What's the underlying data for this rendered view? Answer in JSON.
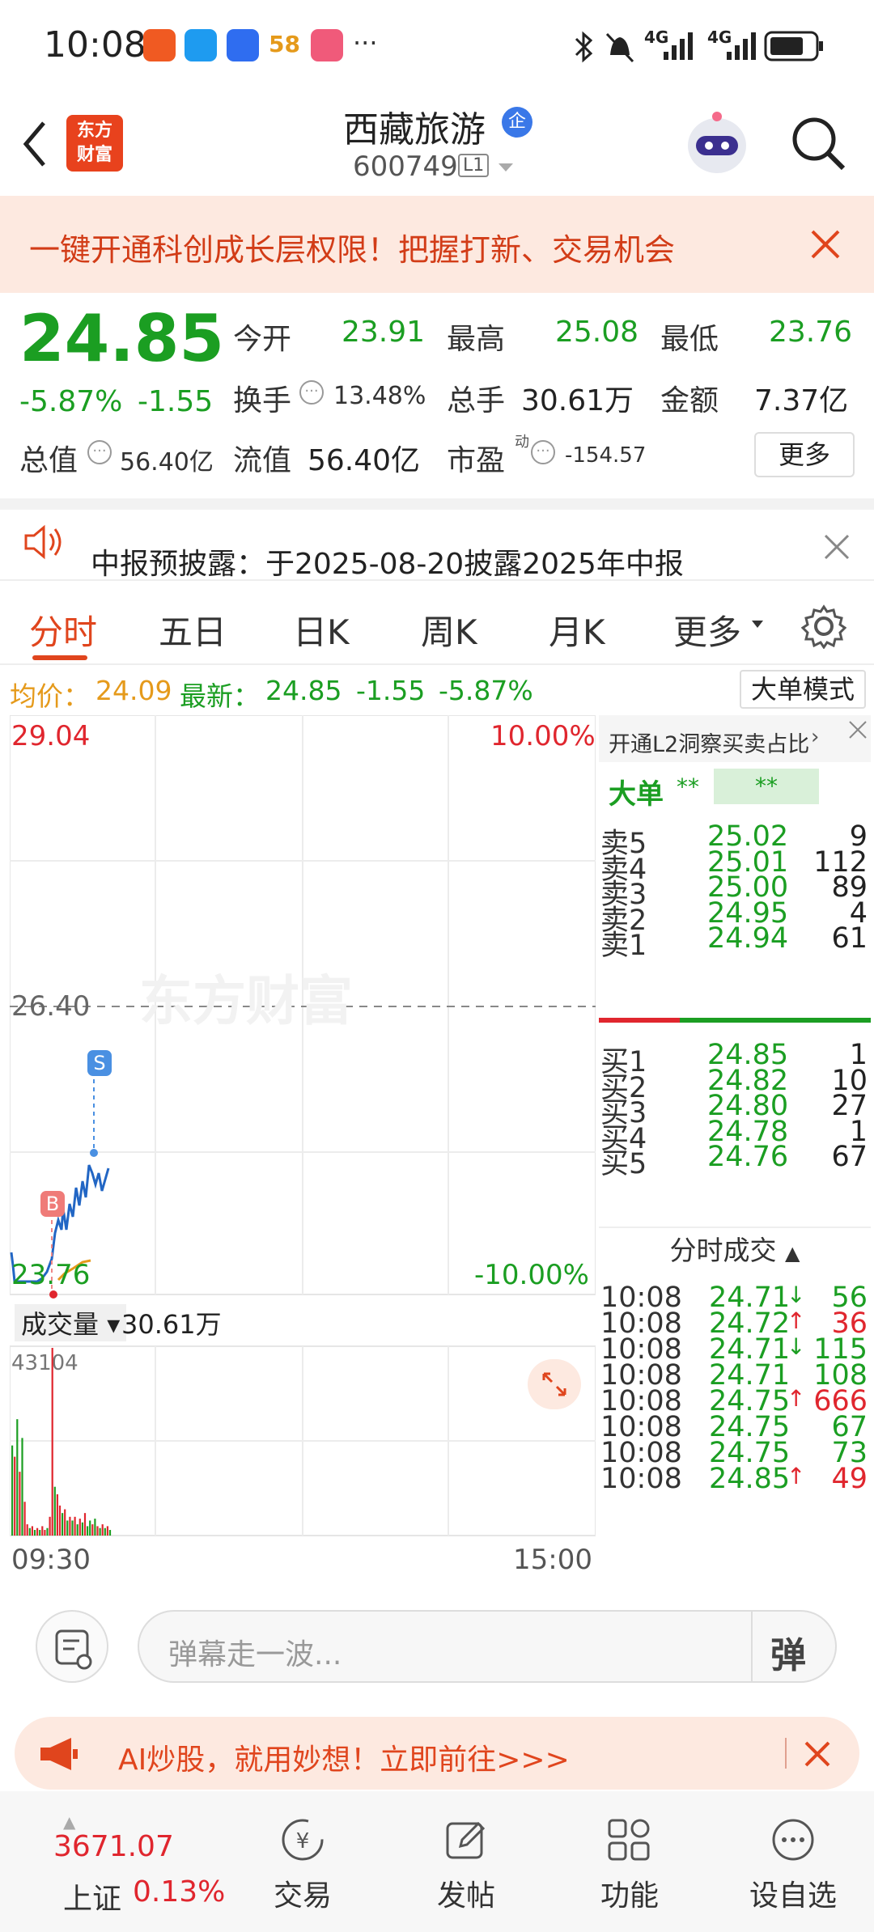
{
  "status_bar": {
    "time": "10:08",
    "more": "···",
    "net1": "4G",
    "net2": "4G"
  },
  "header": {
    "back": "‹",
    "logo_line1": "东方",
    "logo_line2": "财富",
    "title": "西藏旅游",
    "title_badge": "企",
    "code": "600749",
    "level": "L1"
  },
  "banner": {
    "text": "一键开通科创成长层权限！把握打新、交易机会"
  },
  "quote": {
    "price": "24.85",
    "change_pct": "-5.87%",
    "change": "-1.55",
    "open_label": "今开",
    "open": "23.91",
    "high_label": "最高",
    "high": "25.08",
    "low_label": "最低",
    "low": "23.76",
    "turnover_label": "换手",
    "turnover": "13.48%",
    "volume_label": "总手",
    "volume": "30.61万",
    "amount_label": "金额",
    "amount": "7.37亿",
    "mcap_label": "总值",
    "mcap": "56.40亿",
    "float_label": "流值",
    "float": "56.40亿",
    "pe_label": "市盈",
    "pe_sup": "动",
    "pe": "-154.57",
    "more_button": "更多"
  },
  "notice": {
    "text": "中报预披露：于2025-08-20披露2025年中报"
  },
  "tabs": [
    "分时",
    "五日",
    "日K",
    "周K",
    "月K",
    "更多"
  ],
  "price_line": {
    "avg_label": "均价：",
    "avg": "24.09",
    "last_label": "最新：",
    "last": "24.85",
    "chg": "-1.55",
    "pct": "-5.87%",
    "big_order_mode": "大单模式"
  },
  "chart": {
    "y_top": "29.04",
    "y_mid": "26.40",
    "y_bottom": "23.76",
    "pct_top": "10.00%",
    "pct_bottom": "-10.00%",
    "watermark": "东方财富",
    "volume_label": "成交量",
    "volume_total": "30.61万",
    "volume_max": "43104",
    "time_start": "09:30",
    "time_end": "15:00",
    "buy_marker": "B",
    "sell_marker": "S",
    "colors": {
      "price": "#2266c4",
      "avg": "#e59a1b",
      "up": "#e0262e",
      "down": "#1b9e22"
    }
  },
  "order_book": {
    "l2_link": "开通L2洞察买卖占比",
    "big_order_label": "大单",
    "big_order_val1": "**",
    "big_order_val2": "**",
    "asks": [
      {
        "label": "卖5",
        "price": "25.02",
        "qty": "9"
      },
      {
        "label": "卖4",
        "price": "25.01",
        "qty": "112"
      },
      {
        "label": "卖3",
        "price": "25.00",
        "qty": "89"
      },
      {
        "label": "卖2",
        "price": "24.95",
        "qty": "4"
      },
      {
        "label": "卖1",
        "price": "24.94",
        "qty": "61"
      }
    ],
    "bids": [
      {
        "label": "买1",
        "price": "24.85",
        "qty": "1"
      },
      {
        "label": "买2",
        "price": "24.82",
        "qty": "10"
      },
      {
        "label": "买3",
        "price": "24.80",
        "qty": "27"
      },
      {
        "label": "买4",
        "price": "24.78",
        "qty": "1"
      },
      {
        "label": "买5",
        "price": "24.76",
        "qty": "67"
      }
    ],
    "ticks_header": "分时成交",
    "ticks": [
      {
        "time": "10:08",
        "price": "24.71",
        "arrow": "↓",
        "qty": "56",
        "dir": "down"
      },
      {
        "time": "10:08",
        "price": "24.72",
        "arrow": "↑",
        "qty": "36",
        "dir": "up"
      },
      {
        "time": "10:08",
        "price": "24.71",
        "arrow": "↓",
        "qty": "115",
        "dir": "down"
      },
      {
        "time": "10:08",
        "price": "24.71",
        "arrow": "",
        "qty": "108",
        "dir": "down"
      },
      {
        "time": "10:08",
        "price": "24.75",
        "arrow": "↑",
        "qty": "666",
        "dir": "up"
      },
      {
        "time": "10:08",
        "price": "24.75",
        "arrow": "",
        "qty": "67",
        "dir": "down"
      },
      {
        "time": "10:08",
        "price": "24.75",
        "arrow": "",
        "qty": "73",
        "dir": "down"
      },
      {
        "time": "10:08",
        "price": "24.85",
        "arrow": "↑",
        "qty": "49",
        "dir": "up"
      }
    ]
  },
  "comment": {
    "placeholder": "弹幕走一波...",
    "danmu_button": "弹"
  },
  "ad": {
    "text": "AI炒股，就用妙想！立即前往>>>"
  },
  "bottom_nav": {
    "index_value": "3671.07",
    "index_name": "上证",
    "index_pct": "0.13%",
    "items": [
      "交易",
      "发帖",
      "功能",
      "设自选"
    ]
  }
}
